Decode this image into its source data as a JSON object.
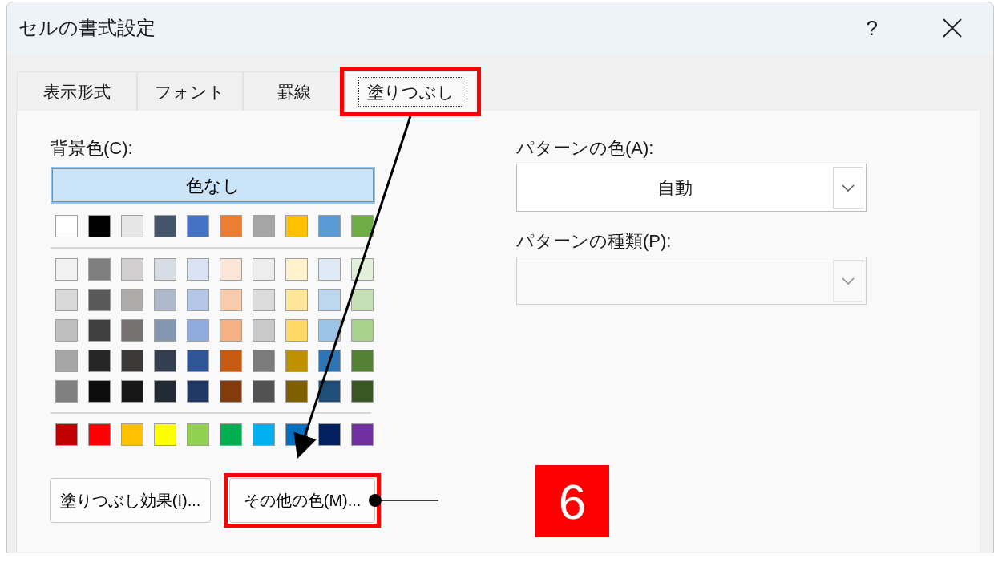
{
  "window": {
    "title": "セルの書式設定",
    "help": "?"
  },
  "tabs": [
    {
      "label": "表示形式",
      "selected": false
    },
    {
      "label": "フォント",
      "selected": false
    },
    {
      "label": "罫線",
      "selected": false
    },
    {
      "label": "塗りつぶし",
      "selected": true,
      "highlighted": true
    }
  ],
  "background_color": {
    "label": "背景色(C):",
    "no_color_button": {
      "label": "色なし",
      "selected": true
    },
    "theme_row": [
      {
        "color": "#ffffff"
      },
      {
        "color": "#000000"
      },
      {
        "color": "#e7e6e6"
      },
      {
        "color": "#44546a"
      },
      {
        "color": "#4472c4"
      },
      {
        "color": "#ed7d31"
      },
      {
        "color": "#a5a5a5"
      },
      {
        "color": "#ffc000"
      },
      {
        "color": "#5b9bd5"
      },
      {
        "color": "#70ad47"
      }
    ],
    "shade_rows": [
      [
        {
          "color": "#f2f2f2"
        },
        {
          "color": "#7f7f7f"
        },
        {
          "color": "#d0cece"
        },
        {
          "color": "#d6dce4"
        },
        {
          "color": "#dae3f3"
        },
        {
          "color": "#fbe5d6"
        },
        {
          "color": "#ededed"
        },
        {
          "color": "#fff2cc"
        },
        {
          "color": "#deebf7"
        },
        {
          "color": "#e2f0d9"
        }
      ],
      [
        {
          "color": "#d9d9d9"
        },
        {
          "color": "#595959"
        },
        {
          "color": "#aeabab"
        },
        {
          "color": "#adb9ca"
        },
        {
          "color": "#b4c7e7"
        },
        {
          "color": "#f8cbad"
        },
        {
          "color": "#dbdbdb"
        },
        {
          "color": "#ffe699"
        },
        {
          "color": "#bdd7ee"
        },
        {
          "color": "#c5e0b4"
        }
      ],
      [
        {
          "color": "#bfbfbf"
        },
        {
          "color": "#404040"
        },
        {
          "color": "#757171"
        },
        {
          "color": "#8497b0"
        },
        {
          "color": "#8faadc"
        },
        {
          "color": "#f4b183"
        },
        {
          "color": "#c9c9c9"
        },
        {
          "color": "#ffd966"
        },
        {
          "color": "#9dc3e6"
        },
        {
          "color": "#a9d18e"
        }
      ],
      [
        {
          "color": "#a6a6a6"
        },
        {
          "color": "#262626"
        },
        {
          "color": "#3b3838"
        },
        {
          "color": "#333f50"
        },
        {
          "color": "#2f5597"
        },
        {
          "color": "#c55a11"
        },
        {
          "color": "#7b7b7b"
        },
        {
          "color": "#bf9000"
        },
        {
          "color": "#2e75b6"
        },
        {
          "color": "#548235"
        }
      ],
      [
        {
          "color": "#808080"
        },
        {
          "color": "#0d0d0d"
        },
        {
          "color": "#171717"
        },
        {
          "color": "#222a35"
        },
        {
          "color": "#203864"
        },
        {
          "color": "#843c0c"
        },
        {
          "color": "#525252"
        },
        {
          "color": "#7f6000"
        },
        {
          "color": "#1f4e79"
        },
        {
          "color": "#385723"
        }
      ]
    ],
    "standard_row": [
      {
        "color": "#c00000"
      },
      {
        "color": "#ff0000"
      },
      {
        "color": "#ffc000"
      },
      {
        "color": "#ffff00"
      },
      {
        "color": "#92d050"
      },
      {
        "color": "#00b050"
      },
      {
        "color": "#00b0f0"
      },
      {
        "color": "#0070c0"
      },
      {
        "color": "#002060"
      },
      {
        "color": "#7030a0"
      }
    ]
  },
  "buttons": [
    {
      "label": "塗りつぶし効果(I)...",
      "highlighted": false
    },
    {
      "label": "その他の色(M)...",
      "highlighted": true
    }
  ],
  "pattern_color": {
    "label": "パターンの色(A):",
    "value": "自動",
    "disabled": false
  },
  "pattern_style": {
    "label": "パターンの種類(P):",
    "disabled": true
  },
  "annotation": {
    "step_badge": "6"
  }
}
